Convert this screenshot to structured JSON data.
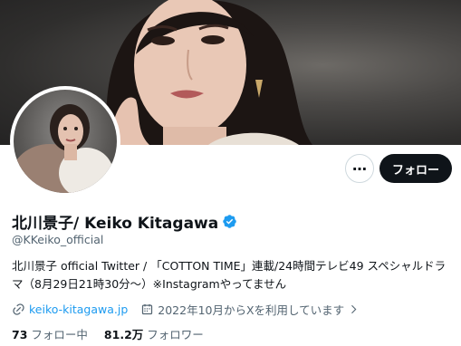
{
  "profile": {
    "display_name": "北川景子/ Keiko Kitagawa",
    "handle": "@KKeiko_official",
    "bio": "北川景子 official Twitter / 「COTTON TIME」連載/24時間テレビ49 スペシャルドラマ（8月29日21時30分～）※Instagramやってません",
    "website": "keiko-kitagawa.jp",
    "joined": "2022年10月からXを利用しています",
    "following_count": "73",
    "following_label": "フォロー中",
    "followers_count": "81.2万",
    "followers_label": "フォロワー"
  },
  "actions": {
    "more_label": "…",
    "follow_label": "フォロー"
  },
  "icons": {
    "verified": "verified-badge-icon",
    "link": "link-icon",
    "calendar": "calendar-icon",
    "chevron": "chevron-right-icon"
  },
  "colors": {
    "accent": "#1d9bf0",
    "text": "#0f1419",
    "secondary": "#536471",
    "button_dark": "#0f1419"
  }
}
